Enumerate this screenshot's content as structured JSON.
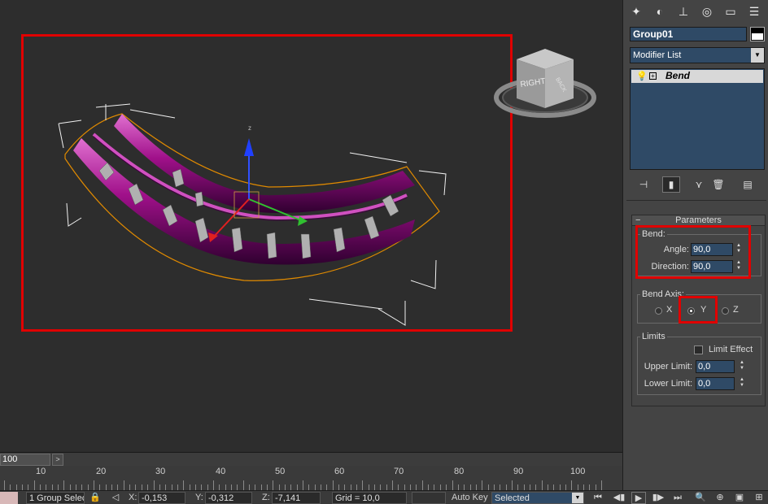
{
  "command_panel": {
    "object_name": "Group01",
    "modifier_list_label": "Modifier List",
    "stack_item": "Bend",
    "rollout_title": "Parameters",
    "bend_group": {
      "title": "Bend:",
      "angle_label": "Angle:",
      "angle_value": "90,0",
      "direction_label": "Direction:",
      "direction_value": "90,0"
    },
    "axis_group": {
      "title": "Bend Axis:",
      "x": "X",
      "y": "Y",
      "z": "Z",
      "selected": "Y"
    },
    "limits_group": {
      "title": "Limits",
      "limit_effect": "Limit Effect",
      "limit_effect_checked": false,
      "upper_label": "Upper Limit:",
      "upper_value": "0,0",
      "lower_label": "Lower Limit:",
      "lower_value": "0,0"
    }
  },
  "viewport": {
    "viewcube_right": "RIGHT",
    "viewcube_back": "BACK",
    "gizmo_z": "z"
  },
  "timeline": {
    "frame_box": "100",
    "next_arrow": ">",
    "ticks": [
      "10",
      "20",
      "30",
      "40",
      "50",
      "60",
      "70",
      "80",
      "90",
      "100"
    ]
  },
  "status": {
    "selection": "1 Group Selec",
    "x_label": "X:",
    "x_value": "-0,153",
    "y_label": "Y:",
    "y_value": "-0,312",
    "z_label": "Z:",
    "z_value": "-7,141",
    "grid": "Grid = 10,0",
    "auto_key": "Auto Key",
    "selected_dropdown": "Selected"
  },
  "colors": {
    "highlight": "#e00000",
    "field_blue": "#2f4a66",
    "mesh_magenta": "#b0108f",
    "bbox_orange": "#e08a00"
  }
}
